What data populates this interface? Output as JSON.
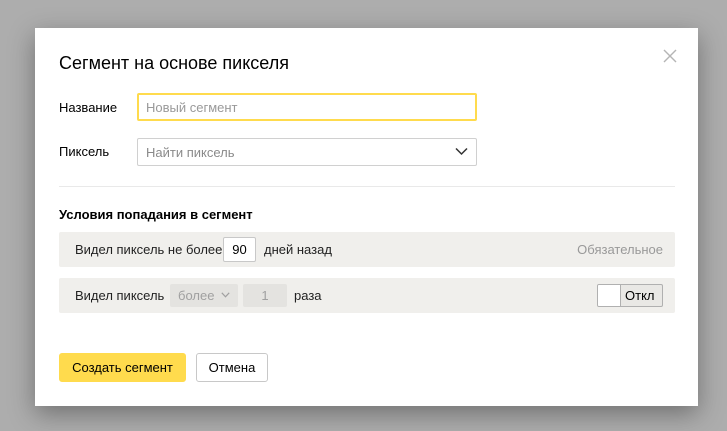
{
  "dialog": {
    "title": "Сегмент на основе пикселя",
    "close_icon": "close-icon"
  },
  "form": {
    "name_label": "Название",
    "name_placeholder": "Новый сегмент",
    "name_value": "",
    "pixel_label": "Пиксель",
    "pixel_placeholder": "Найти пиксель"
  },
  "conditions": {
    "title": "Условия попадания в сегмент",
    "rule1": {
      "prefix": "Видел пиксель не более",
      "days_value": "90",
      "suffix": "дней назад",
      "badge": "Обязательное"
    },
    "rule2": {
      "prefix": "Видел пиксель",
      "operator": "более",
      "count_value": "1",
      "suffix": "раза",
      "toggle_label": "Откл",
      "toggle_state": "off"
    }
  },
  "actions": {
    "create_label": "Создать сегмент",
    "cancel_label": "Отмена"
  },
  "colors": {
    "accent": "#ffdb4d",
    "row_background": "#f0efec",
    "overlay": "#adadad"
  }
}
